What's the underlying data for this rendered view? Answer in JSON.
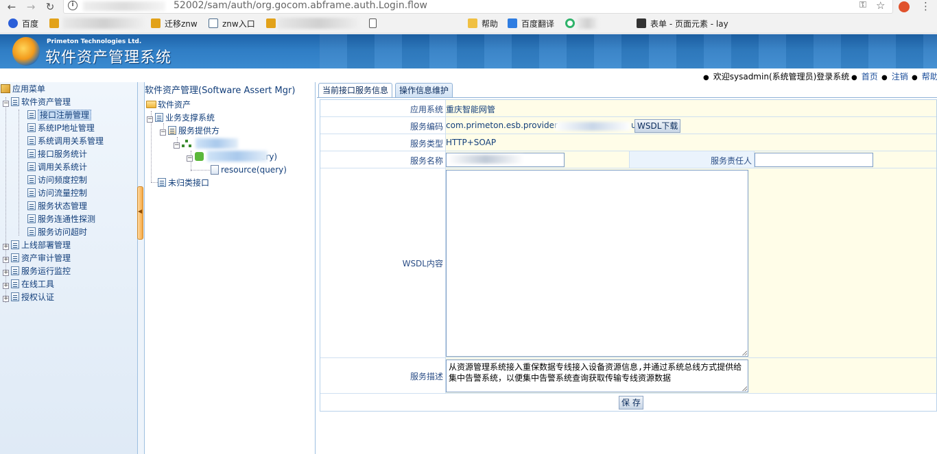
{
  "browser": {
    "address_url": "52002/sam/auth/org.gocom.abframe.auth.Login.flow"
  },
  "bookmarks": [
    {
      "label": "百度",
      "color": "#2b5fd9"
    },
    {
      "label": "迁移znw",
      "color": "#e2a21a"
    },
    {
      "label": "znw入口",
      "color": "#4a6a8a"
    },
    {
      "label": "帮助",
      "color": "#f0c043"
    },
    {
      "label": "百度翻译",
      "color": "#2f7de1"
    },
    {
      "label": "表单 - 页面元素 - lay",
      "color": "#333333"
    }
  ],
  "app": {
    "company": "Primeton Technologies Ltd.",
    "title": "软件资产管理系统"
  },
  "user_bar": {
    "welcome": "欢迎sysadmin(系统管理员)登录系统",
    "home": "首页",
    "logout": "注销",
    "help": "帮助"
  },
  "left_menu": {
    "root": "应用菜单",
    "group_open": "软件资产管理",
    "children": [
      "接口注册管理",
      "系统IP地址管理",
      "系统调用关系管理",
      "接口服务统计",
      "调用关系统计",
      "访问频度控制",
      "访问流量控制",
      "服务状态管理",
      "服务连通性探测",
      "服务访问超时"
    ],
    "groups": [
      "上线部署管理",
      "资产审计管理",
      "服务运行监控",
      "在线工具",
      "授权认证"
    ]
  },
  "mid_tree": {
    "title": "软件资产管理(Software Assert Mgr)",
    "root": "软件资产",
    "business": "业务支撑系统",
    "provider": "服务提供方",
    "query_partial": "ery)",
    "resource": "resource(query)",
    "uncategorized": "未归类接口"
  },
  "tabs": {
    "current": "当前接口服务信息",
    "ops": "操作信息维护"
  },
  "form": {
    "app_system_label": "应用系统",
    "app_system_value": "重庆智能网管",
    "service_code_label": "服务编码",
    "service_code_value": "com.primeton.esb.provider.",
    "service_code_suffix": "u",
    "wsdl_download": "WSDL下载",
    "service_type_label": "服务类型",
    "service_type_value": "HTTP+SOAP",
    "service_name_label": "服务名称",
    "owner_label": "服务责任人",
    "owner_value": "",
    "wsdl_label": "WSDL内容",
    "wsdl_value": "",
    "desc_label": "服务描述",
    "desc_value": "从资源管理系统接入重保数据专线接入设备资源信息,并通过系统总线方式提供给集中告警系统，以便集中告警系统查询获取传输专线资源数据",
    "save": "保 存"
  }
}
